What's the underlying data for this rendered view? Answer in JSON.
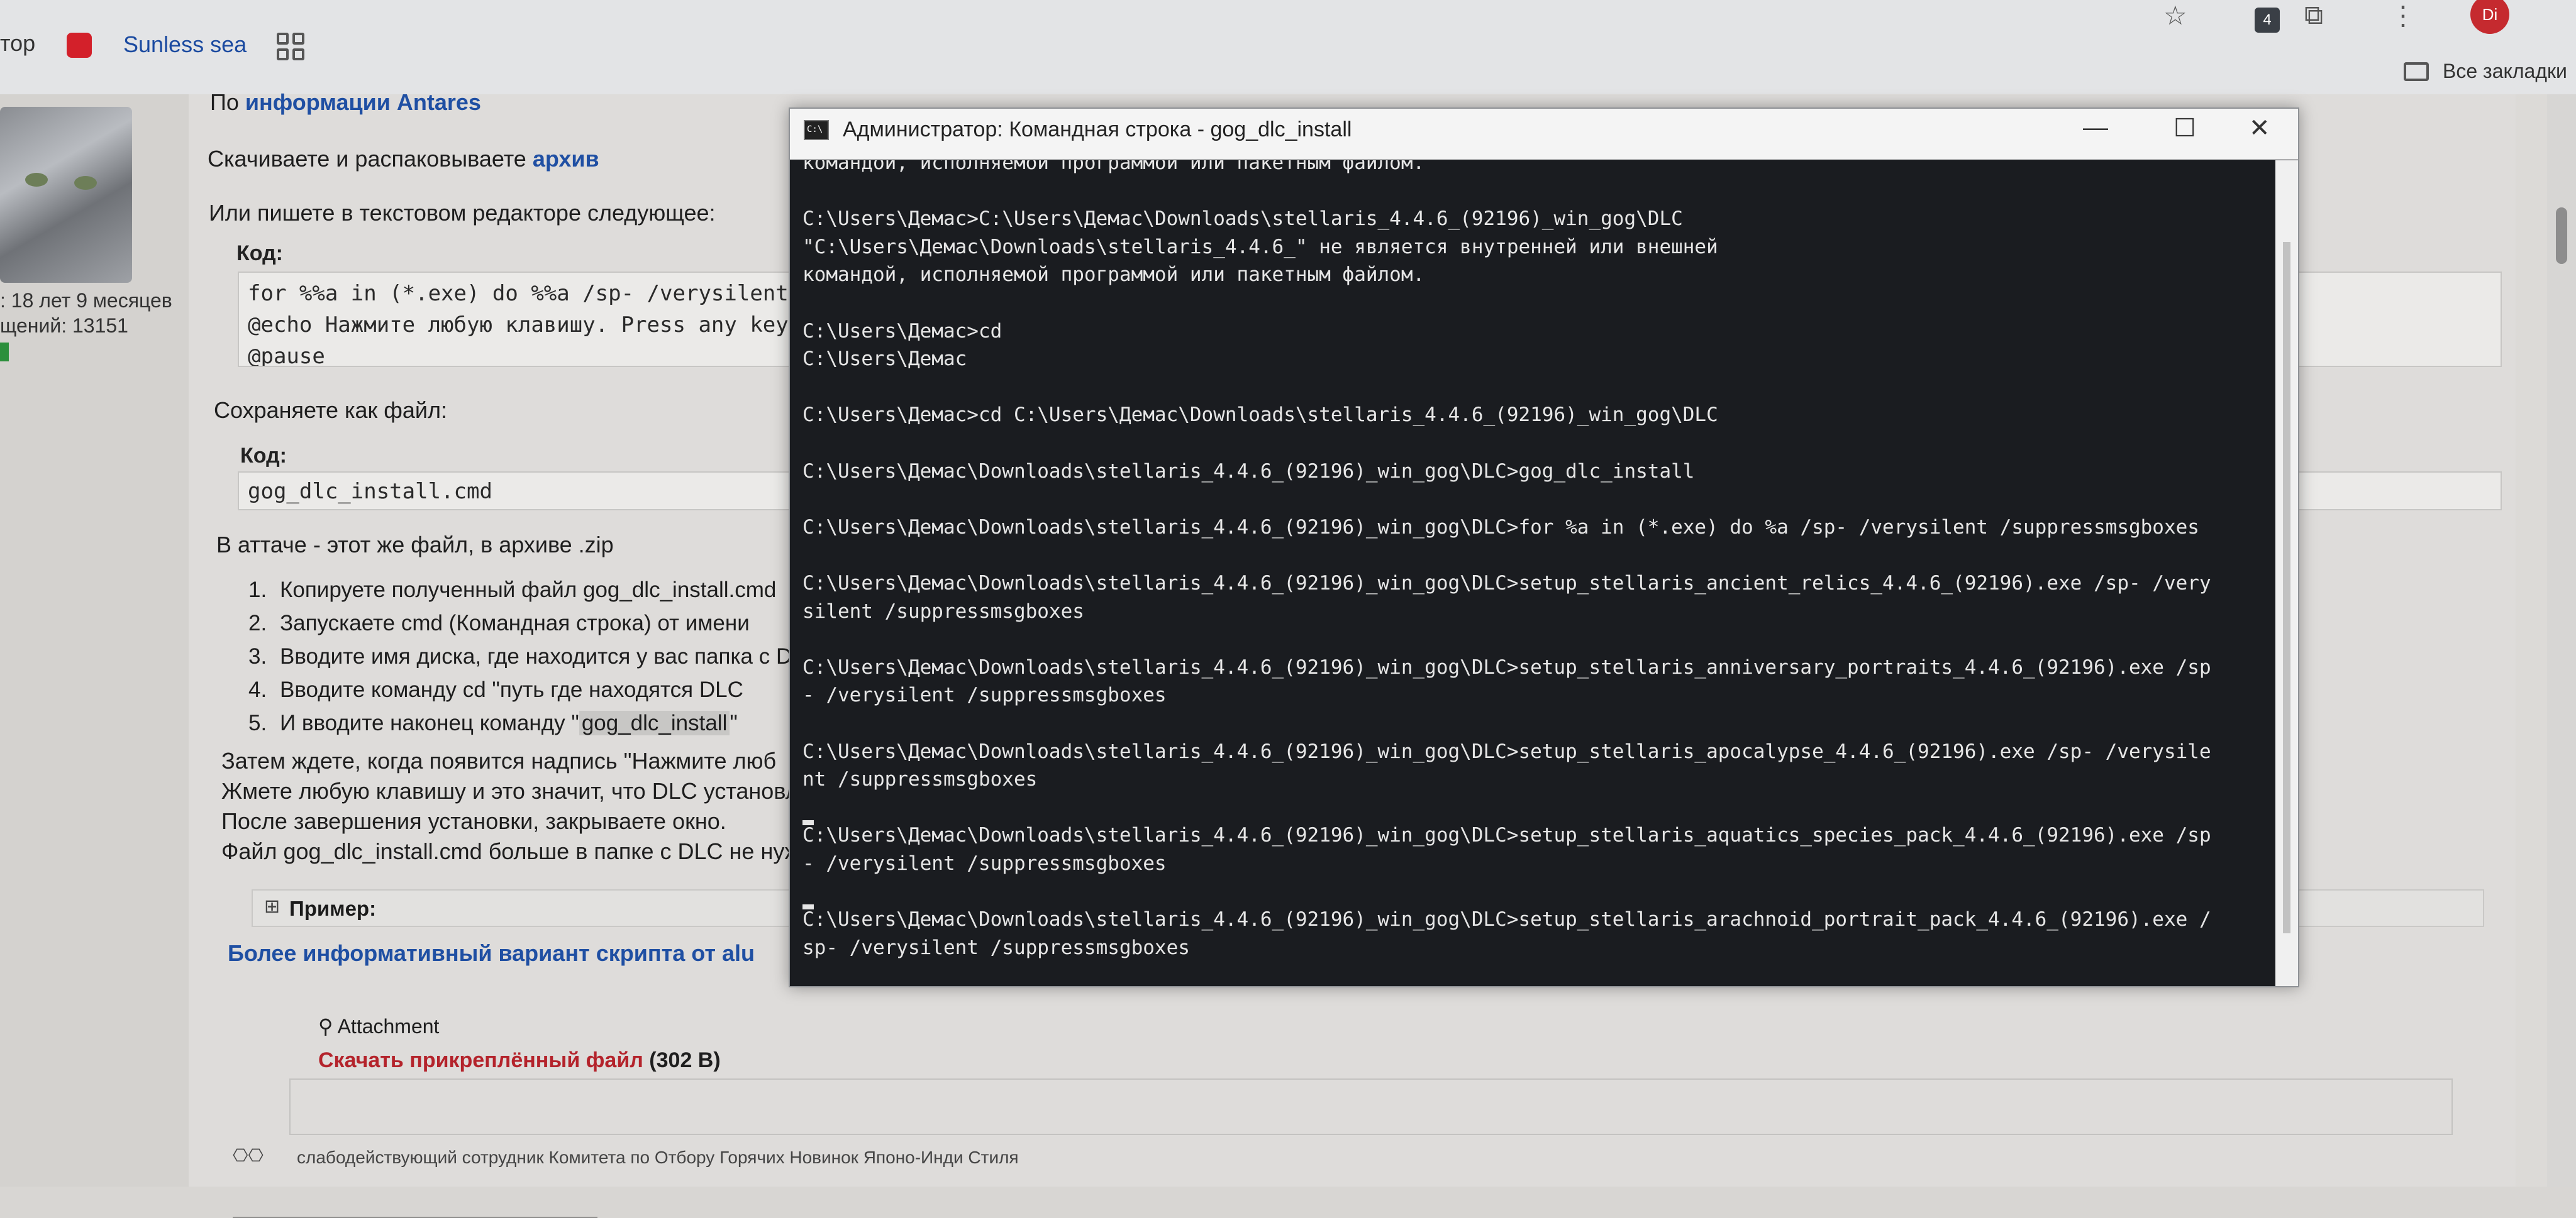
{
  "browser": {
    "bookmark_cut_text": "тор",
    "bookmark_label": "Sunless sea",
    "all_bookmarks_label": "Все закладки",
    "notification_count": "4",
    "profile_initials": "Di"
  },
  "sidebar": {
    "membership": ": 18 лет 9 месяцев",
    "messages": "щений: 13151"
  },
  "post": {
    "intro_prefix": "По ",
    "intro_link": "информации Antares",
    "download_prefix": "Скачиваете и распаковываете ",
    "download_link": "архив",
    "write_line": "Или пишете в текстовом редакторе следующее:",
    "code_label": "Код:",
    "code_lines": [
      "for %%a in (*.exe) do %%a /sp- /verysilent /suppressmsgboxes",
      "@echo Нажмите любую клавишу. Press any key.",
      "@pause"
    ],
    "save_as": "Сохраняете как файл:",
    "code2_label": "Код:",
    "filename_code": "gog_dlc_install.cmd",
    "attach_note": "В аттаче - этот же файл, в архиве .zip",
    "steps": [
      "Копируете полученный файл gog_dlc_install.cmd",
      "Запускаете cmd (Командная строка) от имени",
      "Вводите имя диска, где находится у вас папка с DLC",
      "Вводите команду cd \"путь где находятся DLC"
    ],
    "step5_prefix": "И вводите наконец команду \"",
    "step5_highlight": "gog_dlc_install",
    "step5_suffix": "\"",
    "after_lines": [
      "Затем ждете, когда появится надпись \"Нажмите люб",
      "Жмете любую клавишу и это значит, что DLC установлены",
      "После завершения установки, закрываете окно.",
      "Файл gog_dlc_install.cmd больше в папке с DLC не нужен, можно его удалить."
    ],
    "example_label": "Пример:",
    "better_variant": "Более информативный вариант скрипта от alu",
    "attachment_title": "Attachment",
    "download_attach": "Скачать прикреплённый файл",
    "attach_size": "(302 В)",
    "signature": "слабодействующий сотрудник Комитета по Отбору Горячих Новинок Японо-Инди Стиля"
  },
  "cmd": {
    "title": "Администратор: Командная строка - gog_dlc_install",
    "lines": [
      "командой, исполняемой программой или пакетным файлом.",
      "",
      "C:\\Users\\Демас>C:\\Users\\Демас\\Downloads\\stellaris_4.4.6_(92196)_win_gog\\DLC",
      "\"C:\\Users\\Демас\\Downloads\\stellaris_4.4.6_\" не является внутренней или внешней",
      "командой, исполняемой программой или пакетным файлом.",
      "",
      "C:\\Users\\Демас>cd",
      "C:\\Users\\Демас",
      "",
      "C:\\Users\\Демас>cd C:\\Users\\Демас\\Downloads\\stellaris_4.4.6_(92196)_win_gog\\DLC",
      "",
      "C:\\Users\\Демас\\Downloads\\stellaris_4.4.6_(92196)_win_gog\\DLC>gog_dlc_install",
      "",
      "C:\\Users\\Демас\\Downloads\\stellaris_4.4.6_(92196)_win_gog\\DLC>for %a in (*.exe) do %a /sp- /verysilent /suppressmsgboxes",
      "",
      "C:\\Users\\Демас\\Downloads\\stellaris_4.4.6_(92196)_win_gog\\DLC>setup_stellaris_ancient_relics_4.4.6_(92196).exe /sp- /very",
      "silent /suppressmsgboxes",
      "",
      "C:\\Users\\Демас\\Downloads\\stellaris_4.4.6_(92196)_win_gog\\DLC>setup_stellaris_anniversary_portraits_4.4.6_(92196).exe /sp",
      "- /verysilent /suppressmsgboxes",
      "",
      "C:\\Users\\Демас\\Downloads\\stellaris_4.4.6_(92196)_win_gog\\DLC>setup_stellaris_apocalypse_4.4.6_(92196).exe /sp- /verysile",
      "nt /suppressmsgboxes",
      "",
      "C:\\Users\\Демас\\Downloads\\stellaris_4.4.6_(92196)_win_gog\\DLC>setup_stellaris_aquatics_species_pack_4.4.6_(92196).exe /sp",
      "- /verysilent /suppressmsgboxes",
      "",
      "C:\\Users\\Демас\\Downloads\\stellaris_4.4.6_(92196)_win_gog\\DLC>setup_stellaris_arachnoid_portrait_pack_4.4.6_(92196).exe /",
      "sp- /verysilent /suppressmsgboxes"
    ]
  },
  "icons": {
    "star": "☆",
    "extensions": "⧉",
    "more": "⋮",
    "minimize": "—",
    "maximize": "☐",
    "close": "✕"
  },
  "colors": {
    "link": "#1f4fa3",
    "download_link": "#b4232b",
    "console_bg": "#1a1c20"
  }
}
